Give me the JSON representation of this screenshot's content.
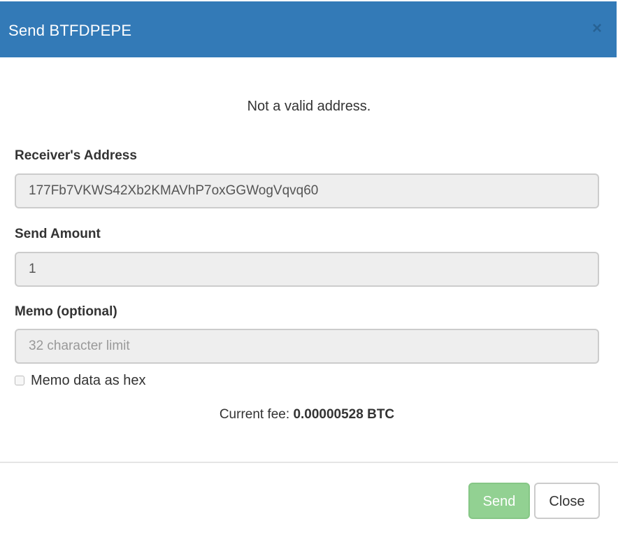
{
  "dialog": {
    "title": "Send BTFDPEPE",
    "close_glyph": "×"
  },
  "body": {
    "error_message": "Not a valid address.",
    "receiver": {
      "label": "Receiver's Address",
      "value": "177Fb7VKWS42Xb2KMAVhP7oxGGWogVqvq60"
    },
    "amount": {
      "label": "Send Amount",
      "value": "1"
    },
    "memo": {
      "label": "Memo (optional)",
      "value": "",
      "placeholder": "32 character limit"
    },
    "memo_hex": {
      "label": "Memo data as hex",
      "checked": false
    },
    "fee": {
      "label": "Current fee:",
      "value": "0.00000528 BTC"
    }
  },
  "footer": {
    "send_label": "Send",
    "close_label": "Close"
  },
  "colors": {
    "header_bg": "#337ab7",
    "send_button_bg": "#92d192",
    "input_bg": "#eeeeee"
  }
}
